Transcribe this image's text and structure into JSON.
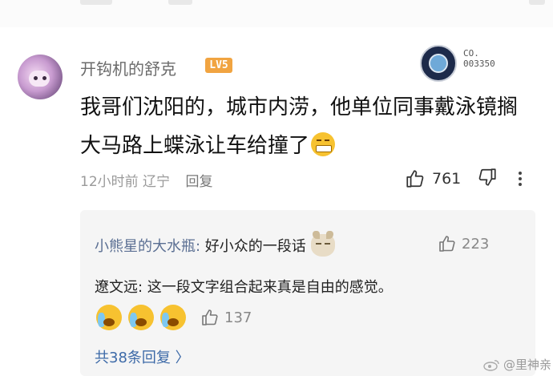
{
  "comment": {
    "username": "开钩机的舒克",
    "level": "LV5",
    "medal_text": "CO.\n003350",
    "text": "我哥们沈阳的，城市内涝，他单位同事戴泳镜搁大马路上蝶泳让车给撞了",
    "time": "12小时前",
    "location": "辽宁",
    "reply_label": "回复",
    "like_count": "761"
  },
  "replies": {
    "reply1_name": "小熊星的大水瓶:",
    "reply1_text": " 好小众的一段话",
    "reply1_like_count": "223",
    "reply2_name": "遼文远:",
    "reply2_text": " 这一段文字组合起来真是自由的感觉。",
    "reply2_like_count": "137",
    "more_label": "共38条回复 〉"
  },
  "watermark": "@里神亲",
  "colors": {
    "level_badge": "#f1a441",
    "reply_name": "#5b6f93",
    "more_link": "#3d6aa8"
  }
}
